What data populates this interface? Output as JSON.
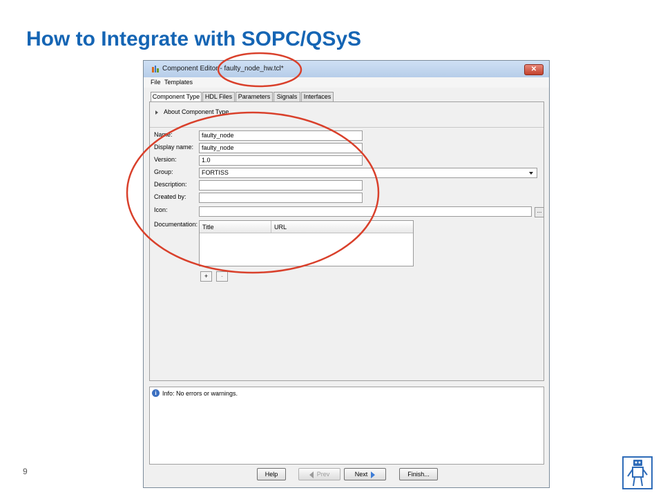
{
  "slide": {
    "title": "How to Integrate with SOPC/QSyS",
    "page_number": "9"
  },
  "window": {
    "title": "Component Editor - faulty_node_hw.tcl*",
    "close_label": "✕"
  },
  "menu": {
    "file": "File",
    "templates": "Templates"
  },
  "tabs": [
    "Component Type",
    "HDL Files",
    "Parameters",
    "Signals",
    "Interfaces"
  ],
  "about": "About Component Type",
  "form": {
    "name_label": "Name:",
    "name_value": "faulty_node",
    "display_name_label": "Display name:",
    "display_name_value": "faulty_node",
    "version_label": "Version:",
    "version_value": "1.0",
    "group_label": "Group:",
    "group_value": "FORTISS",
    "description_label": "Description:",
    "description_value": "",
    "created_by_label": "Created by:",
    "created_by_value": "",
    "icon_label": "Icon:",
    "icon_value": "",
    "browse_label": "...",
    "documentation_label": "Documentation:",
    "doc_columns": [
      "Title",
      "URL"
    ],
    "add_label": "+",
    "remove_label": "-"
  },
  "info": {
    "message": "Info: No errors or warnings."
  },
  "buttons": {
    "help": "Help",
    "prev": "Prev",
    "next": "Next",
    "finish": "Finish..."
  },
  "colors": {
    "title": "#1565b4",
    "annotation": "#d9402b"
  }
}
